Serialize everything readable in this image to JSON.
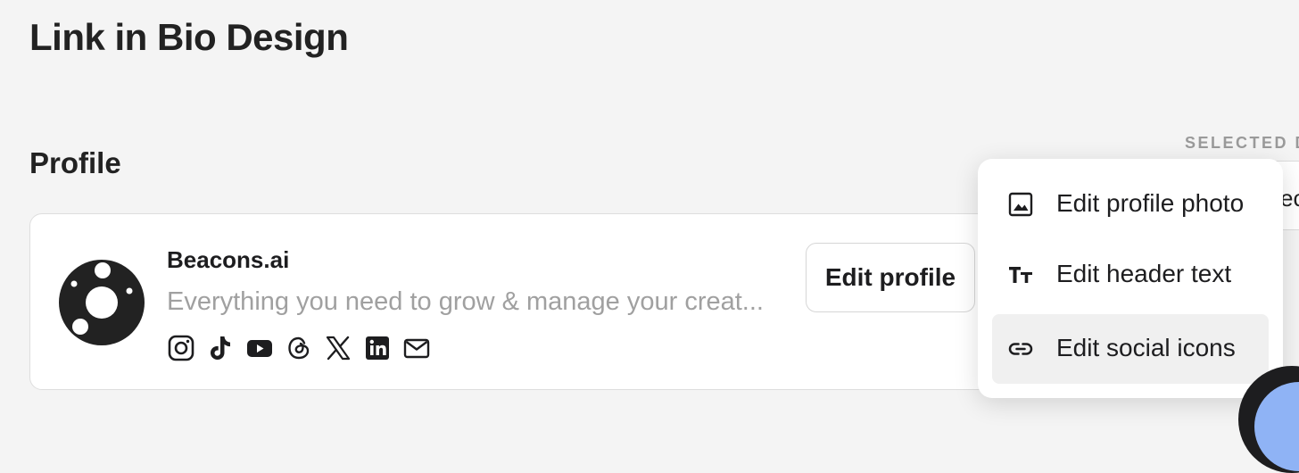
{
  "page": {
    "title": "Link in Bio Design"
  },
  "profile_section": {
    "title": "Profile",
    "selected_label": "SELECTED D",
    "right_pill_text": "ec"
  },
  "profile": {
    "name": "Beacons.ai",
    "bio": "Everything you need to grow & manage your creat...",
    "edit_button": "Edit profile",
    "social_icons": [
      "instagram-icon",
      "tiktok-icon",
      "youtube-icon",
      "threads-icon",
      "x-icon",
      "linkedin-icon",
      "mail-icon"
    ]
  },
  "dropdown": {
    "items": [
      {
        "label": "Edit profile photo",
        "icon": "image-icon"
      },
      {
        "label": "Edit header text",
        "icon": "text-size-icon"
      },
      {
        "label": "Edit social icons",
        "icon": "link-icon",
        "active": true
      }
    ]
  },
  "colors": {
    "background": "#f4f4f4",
    "text": "#1d1d1f",
    "muted": "#a0a0a0",
    "accent_blob": "#8fb3f5"
  }
}
